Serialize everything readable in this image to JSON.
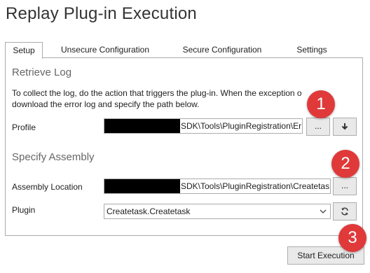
{
  "window": {
    "title": "Replay Plug-in Execution"
  },
  "tabs": [
    {
      "label": "Setup",
      "active": true
    },
    {
      "label": "Unsecure Configuration",
      "active": false
    },
    {
      "label": "Secure Configuration",
      "active": false
    },
    {
      "label": "Settings",
      "active": false
    }
  ],
  "retrieve_log": {
    "heading": "Retrieve Log",
    "description": "To collect the log, do the action that triggers the plug-in. When the exception o download the error log and specify the path below.",
    "profile_label": "Profile",
    "profile_value": "SDK\\Tools\\PluginRegistration\\Er",
    "browse_label": "...",
    "download_icon": "download-arrow-icon"
  },
  "specify_assembly": {
    "heading": "Specify Assembly",
    "assembly_label": "Assembly Location",
    "assembly_value": "SDK\\Tools\\PluginRegistration\\Createtas",
    "browse_label": "...",
    "plugin_label": "Plugin",
    "plugin_value": "Createtask.Createtask",
    "refresh_icon": "refresh-icon"
  },
  "callouts": [
    "1",
    "2",
    "3"
  ],
  "footer": {
    "start_label": "Start Execution"
  },
  "colors": {
    "callout": "#e0393a",
    "border": "#acacac",
    "button": "#e9e9e9"
  }
}
